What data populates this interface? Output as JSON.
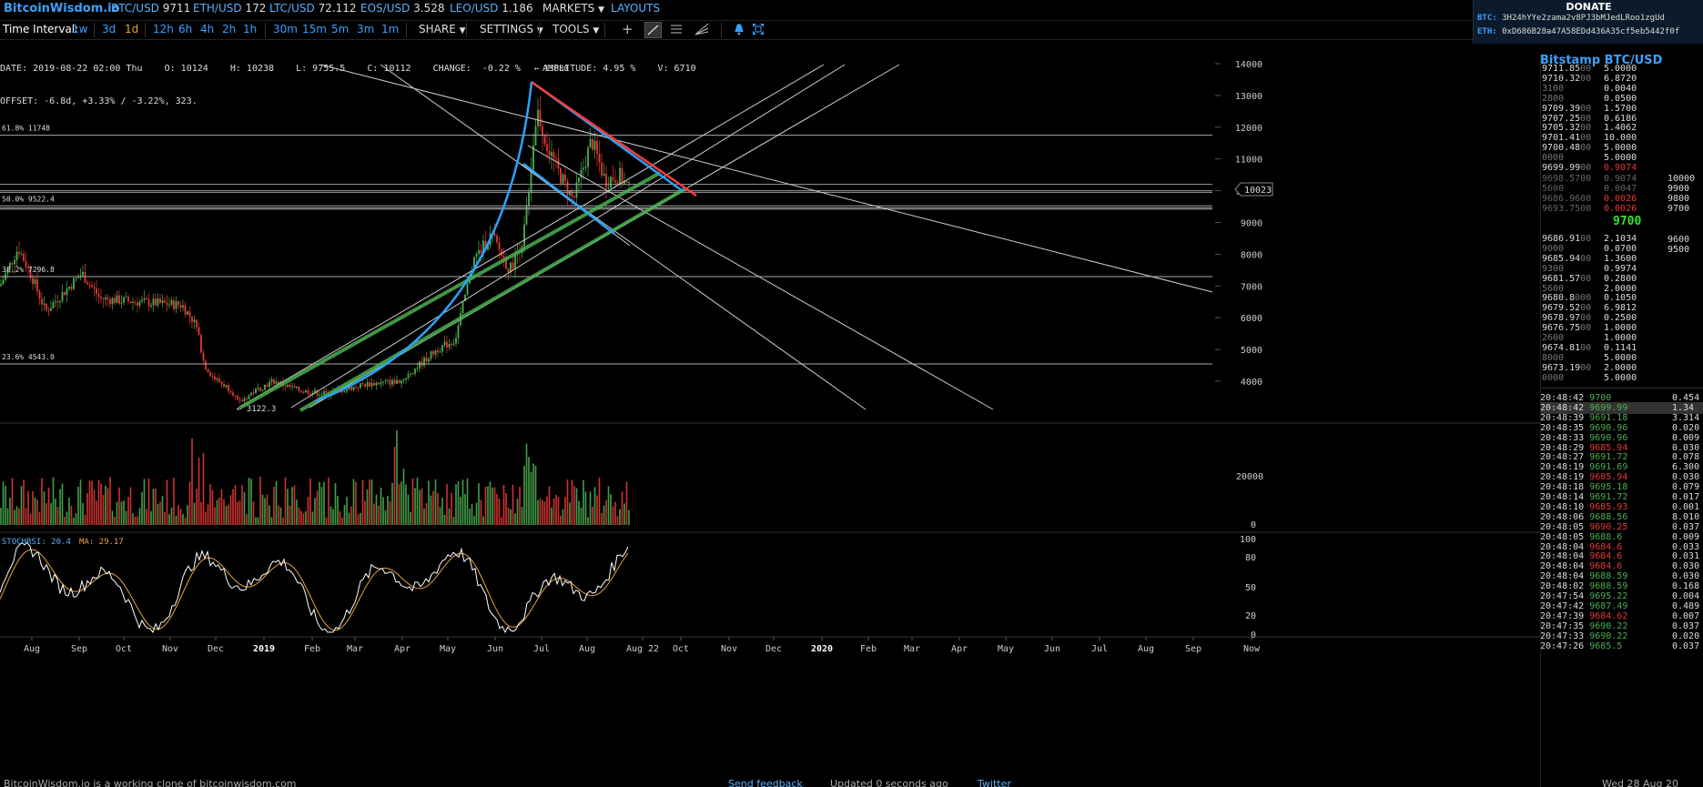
{
  "topbar": {
    "logo": "BitcoinWisdom.io",
    "tickers": [
      {
        "sym": "BTC/USD",
        "price": "9711"
      },
      {
        "sym": "ETH/USD",
        "price": "172"
      },
      {
        "sym": "LTC/USD",
        "price": "72.112"
      },
      {
        "sym": "EOS/USD",
        "price": "3.528"
      },
      {
        "sym": "LEO/USD",
        "price": "1.186"
      }
    ],
    "markets": "MARKETS",
    "layouts": "LAYOUTS"
  },
  "donate": {
    "title": "DONATE",
    "btc_label": "BTC:",
    "btc_addr": "3H24hYYe2zama2v8PJ3bMJedLRoo1zgUd",
    "eth_label": "ETH:",
    "eth_addr": "0xD686B28a47A58EDd436A35cf5eb5442f0f"
  },
  "toolbar": {
    "label": "Time Interval:",
    "intervals": [
      "1w",
      "3d",
      "1d",
      "12h",
      "6h",
      "4h",
      "2h",
      "1h",
      "30m",
      "15m",
      "5m",
      "3m",
      "1m"
    ],
    "active": "1d",
    "share": "SHARE",
    "settings": "SETTINGS",
    "tools": "TOOLS"
  },
  "info": {
    "line1": "DATE: 2019-08-22 02:00 Thu    O: 10124    H: 10238    L: 9755.5    C: 10112    CHANGE:  -0.22 %    AMPLITUDE: 4.95 %    V: 6710",
    "line2": "OFFSET: -6.8d, +3.33% / -3.22%, 323."
  },
  "chart": {
    "fib_levels": [
      "61.8% 11748",
      "50.0% 9522.4",
      "38.2% 7296.8",
      "23.6% 4543.0"
    ],
    "high_label": "← 13880",
    "low_label": "← 3122.3",
    "current_price": "10023",
    "y_ticks": [
      "14000",
      "13000",
      "12000",
      "11000",
      "10000",
      "9000",
      "8000",
      "7000",
      "6000",
      "5000",
      "4000"
    ],
    "vol_tick": "20000",
    "vol_zero": "0",
    "rsi_ticks": [
      "100",
      "80",
      "50",
      "20",
      "0"
    ],
    "stochrsi_label": "STOCHRSI: 20.4",
    "ma_label": "MA: 29.17",
    "x_labels": [
      "Aug",
      "Sep",
      "Oct",
      "Nov",
      "Dec",
      "2019",
      "Feb",
      "Mar",
      "Apr",
      "May",
      "Jun",
      "Jul",
      "Aug",
      "Aug 22",
      "Oct",
      "Nov",
      "Dec",
      "2020",
      "Feb",
      "Mar",
      "Apr",
      "May",
      "Jun",
      "Jul",
      "Aug",
      "Sep",
      "Now"
    ]
  },
  "orderbook": {
    "title": "Bitstamp BTC/USD",
    "asks": [
      [
        "9711.85",
        "00",
        "5.0000"
      ],
      [
        "9710.32",
        "00",
        "6.8720"
      ],
      [
        "",
        "3100",
        "0.0040"
      ],
      [
        "",
        "2800",
        "0.0500"
      ],
      [
        "9709.39",
        "00",
        "1.5700"
      ],
      [
        "9707.25",
        "00",
        "0.6186"
      ],
      [
        "9705.32",
        "00",
        "1.4062"
      ],
      [
        "9701.41",
        "00",
        "10.000"
      ],
      [
        "9700.48",
        "00",
        "5.0000"
      ],
      [
        "",
        "0000",
        "5.0000"
      ],
      [
        "9699.99",
        "00",
        "0.9074"
      ]
    ],
    "mid_gray": [
      [
        "9698.5700",
        "0.9074"
      ],
      [
        "5600",
        "0.0047"
      ],
      [
        "9686.9600",
        "0.0026"
      ],
      [
        "9693.7500",
        "0.0026"
      ]
    ],
    "depth_labels": [
      "10000",
      "9900",
      "9800",
      "9700",
      "9600",
      "9500"
    ],
    "mid_price": "9700",
    "bids": [
      [
        "9686.91",
        "00",
        "2.1034"
      ],
      [
        "",
        "9000",
        "0.0700"
      ],
      [
        "9685.94",
        "00",
        "1.3600"
      ],
      [
        "",
        "9300",
        "0.9974"
      ],
      [
        "9681.57",
        "00",
        "0.2800"
      ],
      [
        "",
        "5600",
        "2.0000"
      ],
      [
        "9680.8",
        "000",
        "0.1050"
      ],
      [
        "9679.52",
        "00",
        "6.9812"
      ],
      [
        "9678.97",
        "00",
        "0.2500"
      ],
      [
        "9676.75",
        "00",
        "1.0000"
      ],
      [
        "",
        "2600",
        "1.0000"
      ],
      [
        "9674.81",
        "00",
        "0.1141"
      ],
      [
        "",
        "8000",
        "5.0000"
      ],
      [
        "9673.19",
        "00",
        "2.0000"
      ],
      [
        "",
        "0000",
        "5.0000"
      ]
    ],
    "trades": [
      [
        "20:48:42",
        "9700",
        "0.454",
        "g"
      ],
      [
        "20:48:42",
        "9699.99",
        "1.34",
        "g"
      ],
      [
        "20:48:39",
        "9691.18",
        "3.314",
        "g"
      ],
      [
        "20:48:35",
        "9690.96",
        "0.020",
        "g"
      ],
      [
        "20:48:33",
        "9690.96",
        "0.009",
        "g"
      ],
      [
        "20:48:29",
        "9685.94",
        "0.030",
        "r"
      ],
      [
        "20:48:27",
        "9691.72",
        "0.078",
        "g"
      ],
      [
        "20:48:19",
        "9691.69",
        "6.300",
        "g"
      ],
      [
        "20:48:19",
        "9685.94",
        "0.030",
        "r"
      ],
      [
        "20:48:18",
        "9695.18",
        "0.079",
        "g"
      ],
      [
        "20:48:14",
        "9691.72",
        "0.017",
        "g"
      ],
      [
        "20:48:10",
        "9685.93",
        "0.001",
        "r"
      ],
      [
        "20:48:06",
        "9688.56",
        "8.010",
        "g"
      ],
      [
        "20:48:05",
        "9690.25",
        "0.037",
        "r"
      ],
      [
        "20:48:05",
        "9688.6",
        "0.009",
        "g"
      ],
      [
        "20:48:04",
        "9684.6",
        "0.033",
        "r"
      ],
      [
        "20:48:04",
        "9684.6",
        "0.031",
        "r"
      ],
      [
        "20:48:04",
        "9684.6",
        "0.030",
        "r"
      ],
      [
        "20:48:04",
        "9688.59",
        "0.030",
        "g"
      ],
      [
        "20:48:02",
        "9688.59",
        "0.168",
        "g"
      ],
      [
        "20:47:54",
        "9695.22",
        "0.004",
        "g"
      ],
      [
        "20:47:42",
        "9687.49",
        "0.489",
        "g"
      ],
      [
        "20:47:39",
        "9684.62",
        "0.007",
        "r"
      ],
      [
        "20:47:35",
        "9690.22",
        "0.037",
        "g"
      ],
      [
        "20:47:33",
        "9690.22",
        "0.020",
        "g"
      ],
      [
        "20:47:26",
        "9685.5",
        "0.037",
        "g"
      ]
    ]
  },
  "footer": {
    "left": "BitcoinWisdom.io is a working clone of bitcoinwisdom.com",
    "send": "Send feedback",
    "updated": "Updated 0 seconds ago",
    "twitter": "Twitter",
    "date": "Wed 28 Aug 20"
  },
  "colors": {
    "accent": "#3ba0ff",
    "up": "#4caf50",
    "down": "#e53935",
    "bg": "#000000"
  }
}
